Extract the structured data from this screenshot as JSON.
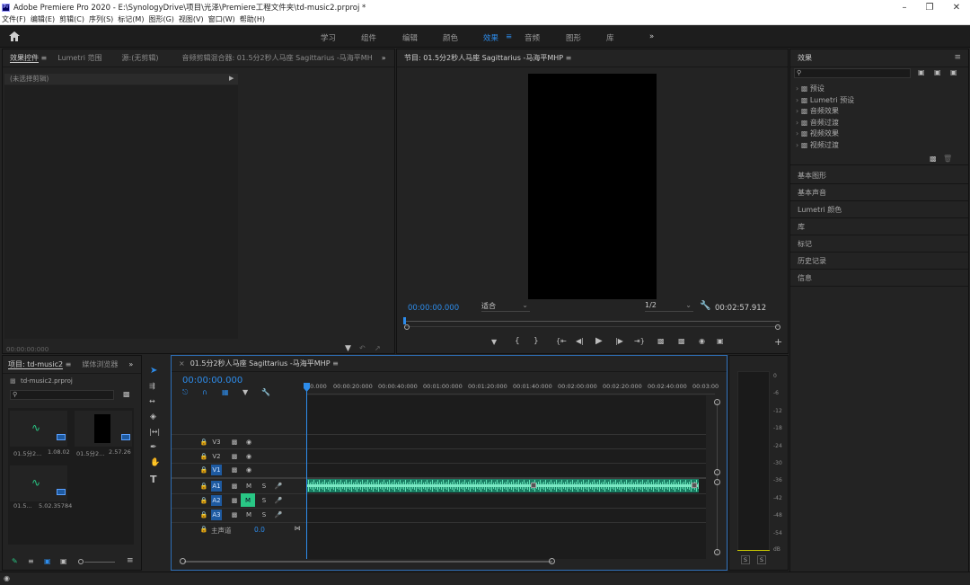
{
  "window": {
    "title": "Adobe Premiere Pro 2020 - E:\\SynologyDrive\\项目\\光泽\\Premiere工程文件夹\\td-music2.prproj *",
    "app_icon": "Pr",
    "controls": [
      "minimize-icon",
      "maximize-icon",
      "close-icon"
    ]
  },
  "menu": [
    "文件(F)",
    "编辑(E)",
    "剪辑(C)",
    "序列(S)",
    "标记(M)",
    "图形(G)",
    "视图(V)",
    "窗口(W)",
    "帮助(H)"
  ],
  "workspaces": [
    "学习",
    "组件",
    "编辑",
    "颜色",
    "效果",
    "音频",
    "图形",
    "库"
  ],
  "active_workspace": "效果",
  "more_glyph": "»",
  "source_panel": {
    "tabs": [
      "效果控件",
      "Lumetri 范围",
      "源:(无剪辑)",
      "音频剪辑混合器: 01.5分2秒人马座 Sagittarius -马海平MH"
    ],
    "no_clip": "(未选择剪辑)",
    "timecode": "00:00:00:000"
  },
  "program_monitor": {
    "title": "节目: 01.5分2秒人马座 Sagittarius -马海平MHP",
    "timecode": "00:00:00.000",
    "fit": "适合",
    "resolution": "1/2",
    "duration": "00:02:57.912"
  },
  "effects_panel": {
    "title": "效果",
    "search_placeholder": "",
    "folders": [
      "预设",
      "Lumetri 预设",
      "音频效果",
      "音频过渡",
      "视频效果",
      "视频过渡"
    ]
  },
  "right_sections": [
    "基本图形",
    "基本声音",
    "Lumetri 颜色",
    "库",
    "标记",
    "历史记录",
    "信息"
  ],
  "project_panel": {
    "tabs": [
      "项目: td-music2",
      "媒体浏览器"
    ],
    "file": "td-music2.prproj",
    "items": [
      {
        "name": "01.5分2...",
        "duration": "1.08.02"
      },
      {
        "name": "01.5分2...",
        "duration": "2.57.26"
      },
      {
        "name": "01.5...",
        "duration": "5.02.35784"
      }
    ]
  },
  "timeline": {
    "title": "01.5分2秒人马座 Sagittarius -马海平MHP",
    "timecode": "00:00:00.000",
    "ruler": [
      "00.000",
      "00:00:20:000",
      "00:00:40:000",
      "00:01:00:000",
      "00:01:20:000",
      "00:01:40:000",
      "00:02:00:000",
      "00:02:20:000",
      "00:02:40:000",
      "00:03:00"
    ],
    "video_tracks": [
      "V3",
      "V2",
      "V1"
    ],
    "audio_tracks": [
      "A1",
      "A2",
      "A3"
    ],
    "mute_label": "M",
    "solo_label": "S",
    "master": {
      "label": "主声道",
      "value": "0.0"
    }
  },
  "meter": {
    "scale": [
      "0",
      "-6",
      "-12",
      "-18",
      "-24",
      "-30",
      "-36",
      "-42",
      "-48",
      "-54",
      "dB"
    ],
    "solo": [
      "S",
      "S"
    ]
  },
  "colors": {
    "accent": "#2d8ceb",
    "audio_clip": "#1fa07a",
    "waveform": "#5fe0b4",
    "mute_active": "#29c785"
  }
}
